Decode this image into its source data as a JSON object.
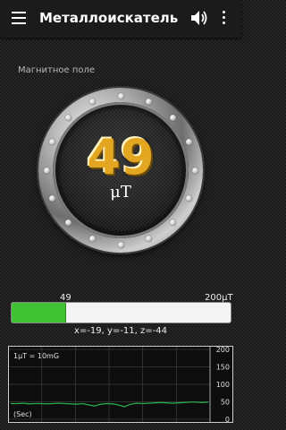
{
  "appbar": {
    "title": "Металлоискатель",
    "menu_icon": "menu-icon",
    "sound_icon": "volume-icon",
    "more_icon": "more-vert-icon"
  },
  "field": {
    "label": "Магнитное поле"
  },
  "gauge": {
    "value": "49",
    "unit": "μT"
  },
  "bar": {
    "value_label": "49",
    "max_label": "200μT",
    "fraction": 0.245,
    "fill_color": "#3fc233"
  },
  "xyz": "x=-19,  y=-11,  z=-44",
  "chart_data": {
    "type": "line",
    "annotation": "1μT = 10mG",
    "xlabel": "(Sec)",
    "ylim": [
      0,
      200
    ],
    "y_ticks": [
      "200",
      "150",
      "100",
      "50",
      "0"
    ],
    "series": [
      {
        "values": [
          45,
          45,
          46,
          44,
          45,
          45,
          44,
          45,
          46,
          45,
          44,
          43,
          45,
          41,
          38,
          43,
          45,
          44,
          41,
          36,
          43,
          46,
          45,
          46,
          47,
          48,
          47,
          46,
          47,
          48,
          49,
          49,
          48,
          49
        ]
      }
    ],
    "line_color": "#2aa84a",
    "grid": true
  }
}
